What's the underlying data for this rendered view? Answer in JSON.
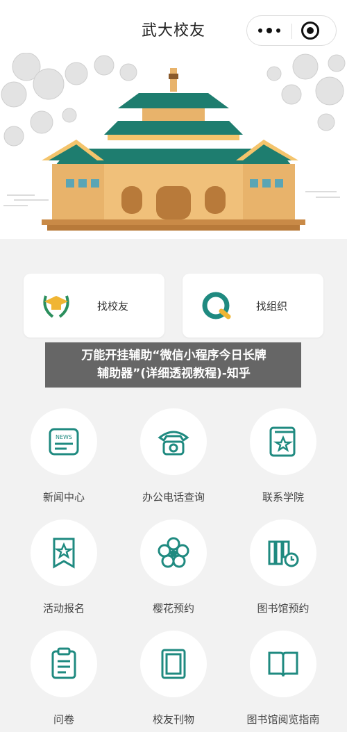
{
  "header": {
    "title": "武大校友"
  },
  "icons": {
    "more": "more-dots-icon",
    "close": "close-target-icon"
  },
  "quick_cards": [
    {
      "label": "找校友",
      "icon": "graduation-cap-laurel-icon"
    },
    {
      "label": "找组织",
      "icon": "q-ring-icon"
    }
  ],
  "overlay": {
    "line1": "万能开挂辅助“微信小程序今日长牌",
    "line2": "辅助器”(详细透视教程)-知乎"
  },
  "grid": {
    "items": [
      {
        "label": "新闻中心",
        "icon": "news-icon"
      },
      {
        "label": "办公电话查询",
        "icon": "telephone-icon"
      },
      {
        "label": "联系学院",
        "icon": "star-book-icon"
      },
      {
        "label": "活动报名",
        "icon": "star-bookmark-icon"
      },
      {
        "label": "樱花预约",
        "icon": "cherry-blossom-icon"
      },
      {
        "label": "图书馆预约",
        "icon": "library-clock-icon"
      },
      {
        "label": "问卷",
        "icon": "clipboard-icon"
      },
      {
        "label": "校友刊物",
        "icon": "magazine-icon"
      },
      {
        "label": "图书馆阅览指南",
        "icon": "open-book-icon"
      }
    ]
  },
  "colors": {
    "accent": "#1f8a80",
    "roof": "#1e7d6f",
    "wall": "#e8b36b",
    "gold": "#f4c46c"
  }
}
